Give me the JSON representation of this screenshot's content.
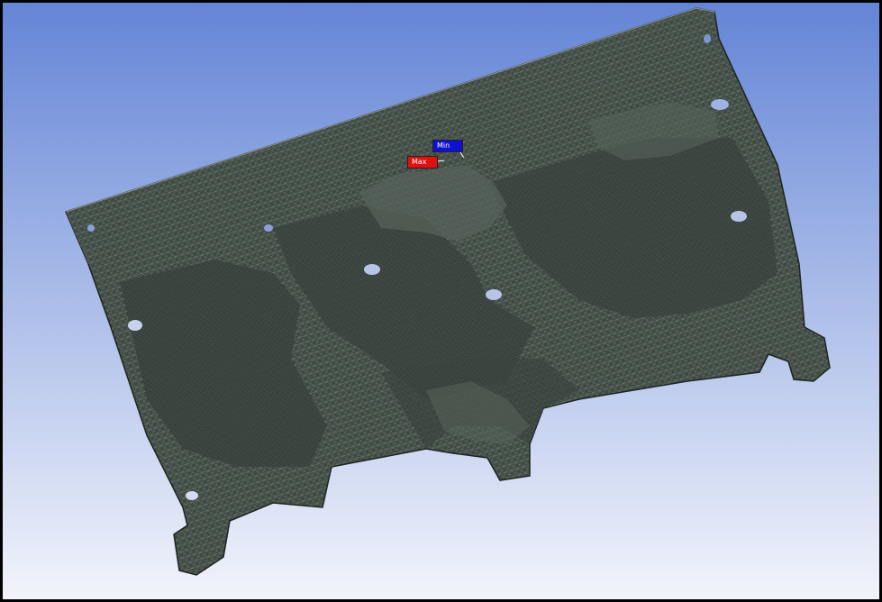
{
  "viewport": {
    "background_top": "#6485d6",
    "background_bottom": "#f2f4fb",
    "frame_color": "#000000",
    "mesh_fill": "#3f4a43",
    "mesh_line": "#b8c7bd",
    "mesh_dark": "#2c3430"
  },
  "probes": {
    "min": {
      "label": "Min",
      "color": "#1010d0"
    },
    "max": {
      "label": "Max",
      "color": "#e01010"
    }
  }
}
